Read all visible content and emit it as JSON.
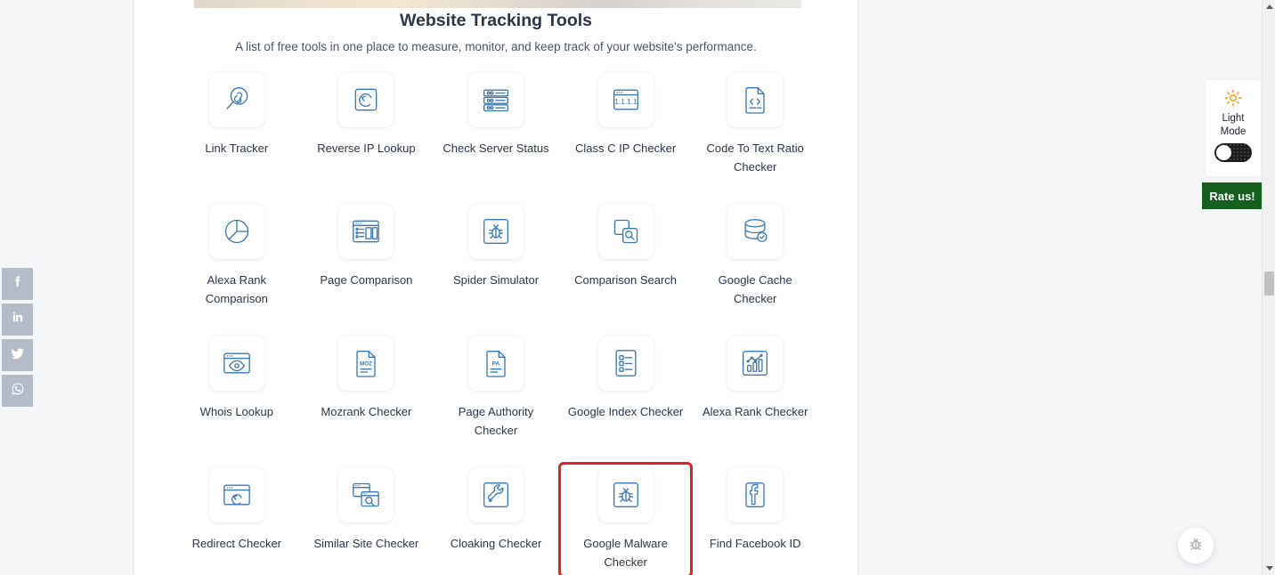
{
  "page": {
    "title": "Website Tracking Tools",
    "subtitle": "A list of free tools in one place to measure, monitor, and keep track of your website's performance."
  },
  "colors": {
    "icon_blue": "#3c78b4",
    "highlight_red": "#ee1c25",
    "rate_green": "#16601f",
    "sun_orange": "#f5a623",
    "social_gray": "#b4bcc9",
    "page_bg": "#f5f6f8",
    "panel_bg": "#ffffff"
  },
  "social_rail": {
    "items": [
      {
        "name": "facebook-share-button",
        "icon": "facebook-icon"
      },
      {
        "name": "linkedin-share-button",
        "icon": "linkedin-icon"
      },
      {
        "name": "twitter-share-button",
        "icon": "twitter-icon"
      },
      {
        "name": "whatsapp-share-button",
        "icon": "whatsapp-icon"
      }
    ]
  },
  "tools": [
    {
      "label": "Link Tracker",
      "icon": "link-magnifier-icon",
      "highlighted": false
    },
    {
      "label": "Reverse IP Lookup",
      "icon": "reverse-arrow-box-icon",
      "highlighted": false
    },
    {
      "label": "Check Server Status",
      "icon": "server-rack-icon",
      "highlighted": false
    },
    {
      "label": "Class C IP Checker",
      "icon": "browser-ip-icon",
      "ip_text": "1.1.1.1",
      "highlighted": false
    },
    {
      "label": "Code To Text Ratio Checker",
      "icon": "code-document-icon",
      "highlighted": false
    },
    {
      "label": "Alexa Rank Comparison",
      "icon": "pie-chart-icon",
      "highlighted": false
    },
    {
      "label": "Page Comparison",
      "icon": "comparison-window-icon",
      "highlighted": false
    },
    {
      "label": "Spider Simulator",
      "icon": "bug-box-icon",
      "highlighted": false
    },
    {
      "label": "Comparison Search",
      "icon": "stacked-squares-search-icon",
      "highlighted": false
    },
    {
      "label": "Google Cache Checker",
      "icon": "database-check-icon",
      "highlighted": false
    },
    {
      "label": "Whois Lookup",
      "icon": "browser-eye-icon",
      "highlighted": false
    },
    {
      "label": "Mozrank Checker",
      "icon": "moz-document-icon",
      "badge_text": "MOZ",
      "highlighted": false
    },
    {
      "label": "Page Authority Checker",
      "icon": "pa-document-icon",
      "badge_text": "PA",
      "highlighted": false
    },
    {
      "label": "Google Index Checker",
      "icon": "checklist-document-icon",
      "highlighted": false
    },
    {
      "label": "Alexa Rank Checker",
      "icon": "bar-chart-trend-icon",
      "highlighted": false
    },
    {
      "label": "Redirect Checker",
      "icon": "browser-redirect-icon",
      "highlighted": false
    },
    {
      "label": "Similar Site Checker",
      "icon": "stacked-browser-search-icon",
      "highlighted": false
    },
    {
      "label": "Cloaking Checker",
      "icon": "wrench-box-icon",
      "highlighted": false
    },
    {
      "label": "Google Malware Checker",
      "icon": "bug-box-icon",
      "highlighted": true
    },
    {
      "label": "Find Facebook ID",
      "icon": "facebook-box-icon",
      "highlighted": false
    }
  ],
  "right_rail": {
    "mode_line1": "Light",
    "mode_line2": "Mode",
    "mode_icon": "sun-icon",
    "toggle_state": "off",
    "rate_label": "Rate us!",
    "fab_icon": "bug-icon"
  },
  "scrollbar": {
    "up_arrow": "scroll-up-arrow",
    "down_arrow": "scroll-down-arrow"
  }
}
